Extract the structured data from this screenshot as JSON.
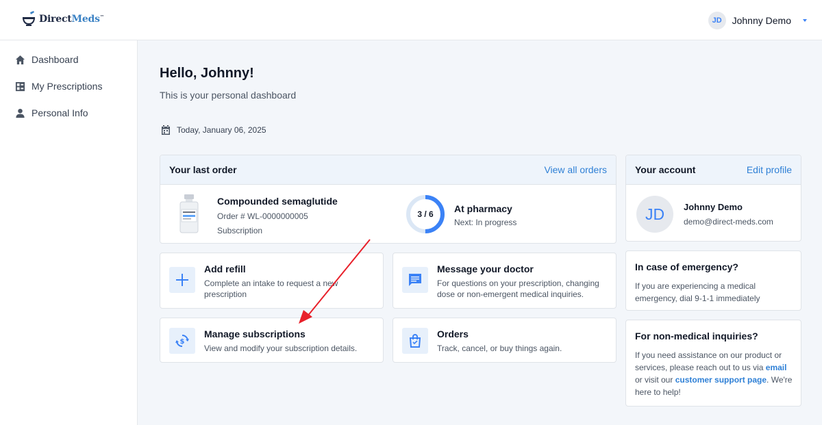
{
  "brand": {
    "name_part1": "Direct",
    "name_part2": "Meds",
    "trademark": "™"
  },
  "user_menu": {
    "initials": "JD",
    "name": "Johnny Demo"
  },
  "sidebar": {
    "items": [
      {
        "label": "Dashboard",
        "icon": "home-icon"
      },
      {
        "label": "My Prescriptions",
        "icon": "prescriptions-icon"
      },
      {
        "label": "Personal Info",
        "icon": "person-icon"
      }
    ]
  },
  "header": {
    "greeting": "Hello, Johnny!",
    "subtitle": "This is your personal dashboard",
    "date": "Today, January 06, 2025"
  },
  "last_order": {
    "title": "Your last order",
    "view_all_label": "View all orders",
    "product_name": "Compounded semaglutide",
    "order_number": "Order # WL-0000000005",
    "order_type": "Subscription",
    "progress_label": "3 / 6",
    "progress_fraction": 0.5,
    "status_title": "At pharmacy",
    "status_next": "Next: In progress"
  },
  "actions": [
    {
      "title": "Add refill",
      "description": "Complete an intake to request a new prescription",
      "icon": "plus-icon"
    },
    {
      "title": "Message your doctor",
      "description": "For questions on your prescription, changing dose or non-emergent medical inquiries.",
      "icon": "message-icon"
    },
    {
      "title": "Manage subscriptions",
      "description": "View and modify your subscription details.",
      "icon": "subscription-refresh-icon"
    },
    {
      "title": "Orders",
      "description": "Track, cancel, or buy things again.",
      "icon": "shopping-bag-icon"
    }
  ],
  "account": {
    "title": "Your account",
    "edit_label": "Edit profile",
    "initials": "JD",
    "name": "Johnny Demo",
    "email": "demo@direct-meds.com"
  },
  "emergency": {
    "title": "In case of emergency?",
    "body": "If you are experiencing a medical emergency, dial 9-1-1 immediately"
  },
  "non_medical": {
    "title": "For non-medical inquiries?",
    "body_part1": "If you need assistance on our product or services, please reach out to us via ",
    "email_link": "email",
    "body_part2": " or visit our ",
    "support_link": "customer support page",
    "body_part3": ". We're here to help!"
  },
  "colors": {
    "accent": "#2f80d6",
    "annotation_arrow": "#e8202a"
  }
}
